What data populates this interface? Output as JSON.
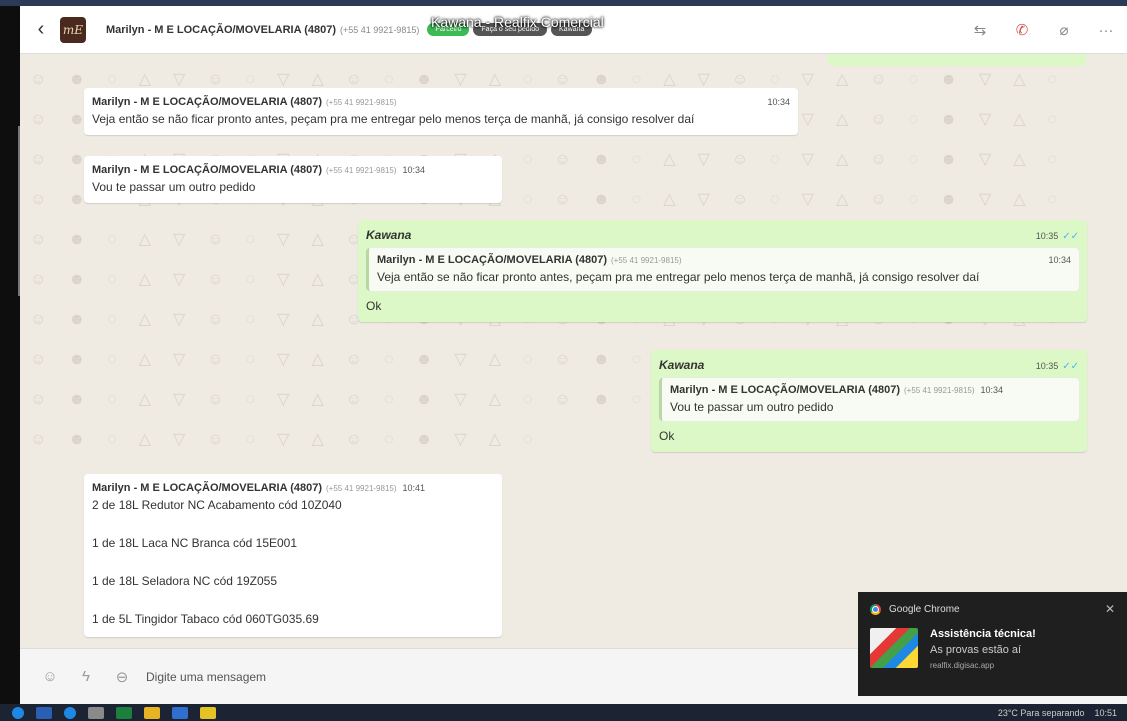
{
  "window": {
    "title": "Kawana - Realfix Comercial"
  },
  "header": {
    "contact_name": "Marilyn - M E LOCAÇÃO/MOVELARIA (4807)",
    "contact_phone": "(+55 41 9921-9815)",
    "avatar_text": "mE",
    "tags": [
      "Parceiro",
      "Faça o seu pedido",
      "Kawana"
    ],
    "back_icon": "chevron-left-icon",
    "actions": [
      "transfer-icon",
      "phone-end-icon",
      "attach-icon",
      "more-icon"
    ]
  },
  "messages": [
    {
      "type": "in",
      "name": "Marilyn - M E LOCAÇÃO/MOVELARIA (4807)",
      "phone": "(+55 41 9921-9815)",
      "time": "10:34",
      "text": "Veja então se não ficar pronto antes, peçam pra me entregar pelo menos terça de manhã, já consigo resolver daí"
    },
    {
      "type": "in",
      "name": "Marilyn - M E LOCAÇÃO/MOVELARIA (4807)",
      "phone": "(+55 41 9921-9815)",
      "time": "10:34",
      "text": "Vou te passar um outro pedido"
    },
    {
      "type": "out",
      "author": "Kawana",
      "time": "10:35",
      "quote": {
        "name": "Marilyn - M E LOCAÇÃO/MOVELARIA (4807)",
        "phone": "(+55 41 9921-9815)",
        "time": "10:34",
        "text": "Veja então se não ficar pronto antes, peçam pra me entregar pelo menos terça de manhã, já consigo resolver daí"
      },
      "text": "Ok"
    },
    {
      "type": "out",
      "author": "Kawana",
      "time": "10:35",
      "quote": {
        "name": "Marilyn - M E LOCAÇÃO/MOVELARIA (4807)",
        "phone": "(+55 41 9921-9815)",
        "time": "10:34",
        "text": "Vou te passar um outro pedido"
      },
      "text": "Ok"
    },
    {
      "type": "in",
      "name": "Marilyn - M E LOCAÇÃO/MOVELARIA (4807)",
      "phone": "(+55 41 9921-9815)",
      "time": "10:41",
      "lines": [
        "2 de 18L Redutor NC Acabamento cód 10Z040",
        "1 de 18L Laca NC Branca cód 15E001",
        "1 de 18L Seladora NC cód 19Z055",
        "1 de 5L Tingidor Tabaco cód 060TG035.69"
      ]
    }
  ],
  "input": {
    "placeholder": "Digite uma mensagem",
    "icons": [
      "emoji-icon",
      "lightning-icon",
      "quick-reply-icon"
    ]
  },
  "notification": {
    "app": "Google Chrome",
    "title": "Assistência técnica!",
    "message": "As provas estão aí",
    "source": "realfix.digisac.app"
  },
  "taskbar": {
    "weather": "23°C  Para separando",
    "clock": "10:51"
  }
}
